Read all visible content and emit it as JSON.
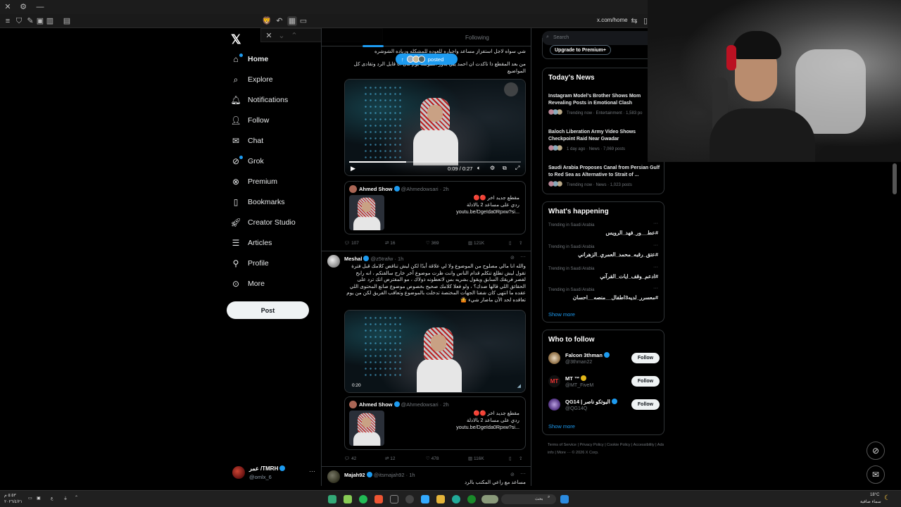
{
  "browser": {
    "url": "x.com/home"
  },
  "nav": {
    "items": [
      {
        "label": "Home",
        "icon": "home-icon"
      },
      {
        "label": "Explore",
        "icon": "search-icon"
      },
      {
        "label": "Notifications",
        "icon": "bell-icon"
      },
      {
        "label": "Follow",
        "icon": "person-add-icon"
      },
      {
        "label": "Chat",
        "icon": "mail-icon"
      },
      {
        "label": "Grok",
        "icon": "grok-icon"
      },
      {
        "label": "Premium",
        "icon": "x-premium-icon"
      },
      {
        "label": "Bookmarks",
        "icon": "bookmark-icon"
      },
      {
        "label": "Creator Studio",
        "icon": "rocket-icon"
      },
      {
        "label": "Articles",
        "icon": "article-icon"
      },
      {
        "label": "Profile",
        "icon": "person-icon"
      },
      {
        "label": "More",
        "icon": "more-circle-icon"
      }
    ],
    "post_label": "Post",
    "account": {
      "name": "عمر /TMRH",
      "handle": "@omlx_6"
    }
  },
  "feed": {
    "tab_following": "Following",
    "posted_pill": "posted",
    "tweet1": {
      "text_line1": "شي سواه لاجل استفزاز مساعد واجباره للعوده للمشكله وزياده الشوشره",
      "text_line2": "من بعد المقطع ذا تاكدت ان احمد يبي يدور الطوشه يوم قال انا قايل الرد وتقادى كل المواضيع",
      "video_time": "0:09 / 0:27",
      "quote": {
        "name": "Ahmed Show",
        "meta": "@Ahmedowsari · 2h",
        "line1": "مقطع جديد اخر 🔴🔴",
        "line2": "ردي على مساعد 2 بالادلة",
        "line3": "youtu.be/DgeIda0Rpxw?si..."
      },
      "stats": {
        "replies": "107",
        "reposts": "16",
        "likes": "369",
        "views": "121K"
      }
    },
    "tweet2": {
      "name": "Meshal",
      "meta": "@z5trafw · 1h",
      "text": "والله انا مالي مصلوح من الموضوع ولا لي علاقة أبدًا لكن ليش تناقض كلامك قبل فترة تقول ليش تطلع تتكلم قدام الناس وانت ظرت موضوع آخر خارج سالفتكم ، انه رابح لفصر فريقك السابق ويقول بشريه بس لاتعطونه ذولاك ، مو المفترض انك ترد على الحقائق اللي قالها ضدك؟ ، ولو فعلا كلامك صحيح بخصوص موضوع صانع المحتوى اللي عقده ما انتهى كان شفنا الجهات المختصة تدخلت بالموضوع وتعاقب الفريق لكن من يوم تعاقده لحد الأن ماصار شيء 🤷",
      "video_time": "0:20",
      "quote": {
        "name": "Ahmed Show",
        "meta": "@Ahmedowsari · 2h",
        "line1": "مقطع جديد اخر 🔴🔴",
        "line2": "ردي على مساعد 2 بالادلة",
        "line3": "youtu.be/DgeIda0Rpxw?si..."
      },
      "stats": {
        "replies": "42",
        "reposts": "12",
        "likes": "478",
        "views": "116K"
      }
    },
    "tweet3": {
      "name": "Majah92",
      "meta": "@itsmajah92 · 1h",
      "text": "مساعد مع راعي المكتب بالرد"
    }
  },
  "right": {
    "search_placeholder": "Search",
    "upgrade_label": "Upgrade to Premium+",
    "news_title": "Today's News",
    "news": [
      {
        "title": "Instagram Model's Brother Shows Mom Revealing Posts in Emotional Clash",
        "meta": "Trending now · Entertainment · 1,583 po"
      },
      {
        "title": "Baloch Liberation Army Video Shows Checkpoint Raid Near Gwadar",
        "meta": "1 day ago · News · 7,069 posts"
      },
      {
        "title": "Saudi Arabia Proposes Canal from Persian Gulf to Red Sea as Alternative to Strait of ...",
        "meta": "Trending now · News · 1,023 posts"
      }
    ],
    "happening_title": "What's happening",
    "trends": [
      {
        "loc": "Trending in Saudi Arabia",
        "tag": "#عط__ور_فهد_الرويس"
      },
      {
        "loc": "Trending in Saudi Arabia",
        "tag": "#عتق_رقبه_محمد_العمري_الزهراني"
      },
      {
        "loc": "Trending in Saudi Arabia",
        "tag": "#ادعم_وقف_ايات_القرآني"
      },
      {
        "loc": "Trending in Saudi Arabia",
        "tag": "#معسرر_لديه3اطفال__منصه__احسان"
      }
    ],
    "show_more": "Show more",
    "wtf_title": "Who to follow",
    "follow_label": "Follow",
    "wtf": [
      {
        "name": "Falcon 3thman",
        "handle": "@3thman22"
      },
      {
        "name": "MT ™",
        "handle": "@MT_FiveM"
      },
      {
        "name": "QG14 | البوتكو ناصر",
        "handle": "@QG14Q"
      }
    ],
    "footer": "Terms of Service  |  Privacy Policy  |  Cookie Policy  |  Accessibility  |  Ads info  |  More ···  © 2026 X Corp."
  },
  "taskbar": {
    "search_label": "بحث",
    "time": "٥:٥٣ م",
    "date": "٢٠٢٦/٤/٢١",
    "weather_temp": "18°C",
    "weather_desc": "سماء صافية",
    "lang": "ع"
  }
}
